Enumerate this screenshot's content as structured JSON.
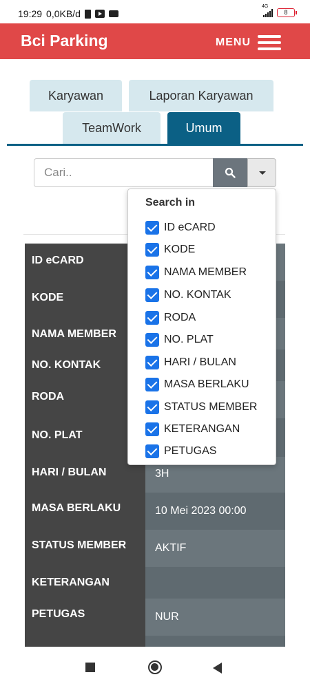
{
  "status_bar": {
    "time": "19:29",
    "speed": "0,0KB/d",
    "network": "4G",
    "battery": "8"
  },
  "app": {
    "title": "Bci Parking",
    "menu_label": "MENU"
  },
  "tabs": [
    "Karyawan",
    "Laporan Karyawan",
    "TeamWork",
    "Umum"
  ],
  "active_tab": "Umum",
  "search": {
    "placeholder": "Cari..",
    "value": ""
  },
  "search_in": {
    "title": "Search in",
    "options": [
      {
        "label": "ID eCARD",
        "checked": true
      },
      {
        "label": "KODE",
        "checked": true
      },
      {
        "label": "NAMA MEMBER",
        "checked": true
      },
      {
        "label": "NO. KONTAK",
        "checked": true
      },
      {
        "label": "RODA",
        "checked": true
      },
      {
        "label": "NO. PLAT",
        "checked": true
      },
      {
        "label": "HARI / BULAN",
        "checked": true
      },
      {
        "label": "MASA BERLAKU",
        "checked": true
      },
      {
        "label": "STATUS MEMBER",
        "checked": true
      },
      {
        "label": "KETERANGAN",
        "checked": true
      },
      {
        "label": "PETUGAS",
        "checked": true
      }
    ]
  },
  "record": [
    {
      "label": "ID eCARD",
      "value": ""
    },
    {
      "label": "KODE",
      "value": ""
    },
    {
      "label": "NAMA MEMBER",
      "value": ""
    },
    {
      "label": "NO. KONTAK",
      "value": ""
    },
    {
      "label": "RODA",
      "value": ""
    },
    {
      "label": "NO. PLAT",
      "value": ""
    },
    {
      "label": "HARI / BULAN",
      "value": "3H"
    },
    {
      "label": "MASA BERLAKU",
      "value": "10 Mei 2023 00:00"
    },
    {
      "label": "STATUS MEMBER",
      "value": "AKTIF"
    },
    {
      "label": "KETERANGAN",
      "value": ""
    },
    {
      "label": "PETUGAS",
      "value": "NUR"
    }
  ],
  "colors": {
    "navbar": "#e04848",
    "tab_active": "#0b6085",
    "tab_inactive": "#d6e8ee",
    "checkbox": "#1a73e8"
  },
  "icons": {
    "search": "search-icon",
    "dropdown": "caret-down-icon",
    "menu": "hamburger-icon"
  }
}
